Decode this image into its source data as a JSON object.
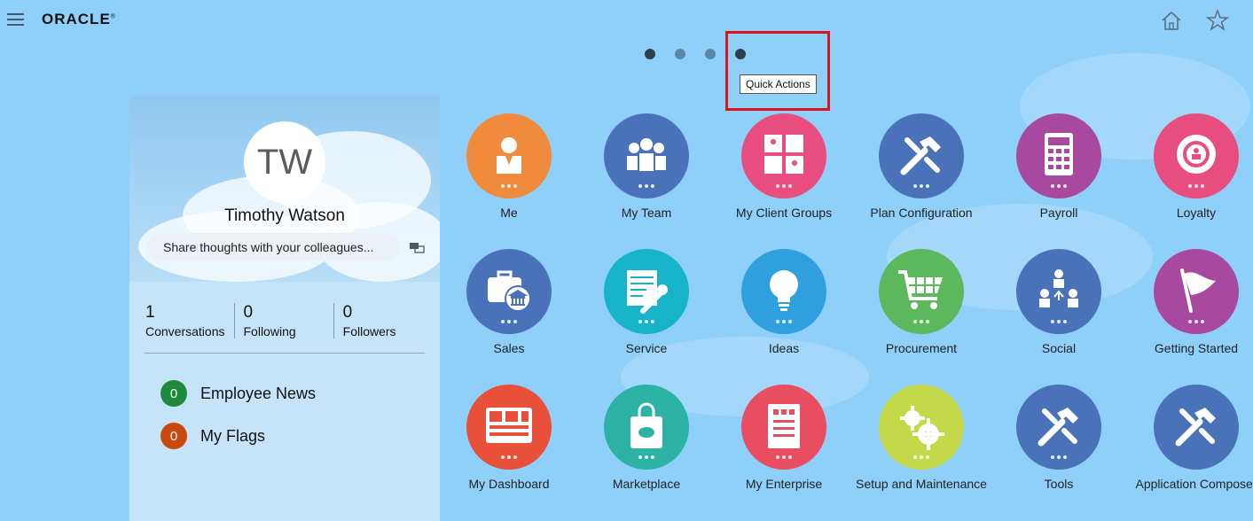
{
  "header": {
    "logo": "ORACLE"
  },
  "carousel": {
    "tooltip": "Quick Actions"
  },
  "profile": {
    "initials": "TW",
    "name": "Timothy Watson",
    "share_placeholder": "Share thoughts with your colleagues...",
    "stats": [
      {
        "value": "1",
        "label": "Conversations"
      },
      {
        "value": "0",
        "label": "Following"
      },
      {
        "value": "0",
        "label": "Followers"
      }
    ],
    "feeds": [
      {
        "count": "0",
        "label": "Employee News",
        "color": "#1e8a3c"
      },
      {
        "count": "0",
        "label": "My Flags",
        "color": "#c9480c"
      }
    ]
  },
  "apps": [
    {
      "label": "Me",
      "icon": "person-icon",
      "color": "#f08a3c"
    },
    {
      "label": "My Team",
      "icon": "team-icon",
      "color": "#4a72b8"
    },
    {
      "label": "My Client Groups",
      "icon": "client-groups-icon",
      "color": "#e84d7f"
    },
    {
      "label": "Plan Configuration",
      "icon": "tools-icon",
      "color": "#4a72b8"
    },
    {
      "label": "Payroll",
      "icon": "calculator-icon",
      "color": "#a849a0"
    },
    {
      "label": "Loyalty",
      "icon": "loyalty-badge-icon",
      "color": "#e84d7f"
    },
    {
      "label": "Sales",
      "icon": "briefcase-bank-icon",
      "color": "#4a72b8"
    },
    {
      "label": "Service",
      "icon": "service-wrench-icon",
      "color": "#17b3c9"
    },
    {
      "label": "Ideas",
      "icon": "lightbulb-icon",
      "color": "#2f9fde"
    },
    {
      "label": "Procurement",
      "icon": "cart-icon",
      "color": "#5bb85c"
    },
    {
      "label": "Social",
      "icon": "social-network-icon",
      "color": "#4a72b8"
    },
    {
      "label": "Getting Started",
      "icon": "flag-icon",
      "color": "#a849a0"
    },
    {
      "label": "My Dashboard",
      "icon": "dashboard-icon",
      "color": "#e8503a"
    },
    {
      "label": "Marketplace",
      "icon": "shopping-bag-icon",
      "color": "#2cb3a6"
    },
    {
      "label": "My Enterprise",
      "icon": "building-icon",
      "color": "#e84d62"
    },
    {
      "label": "Setup and Maintenance",
      "icon": "gears-icon",
      "color": "#c3d94a"
    },
    {
      "label": "Tools",
      "icon": "tools-icon",
      "color": "#4a72b8"
    },
    {
      "label": "Application Composer",
      "icon": "tools-icon",
      "color": "#4a72b8"
    }
  ]
}
